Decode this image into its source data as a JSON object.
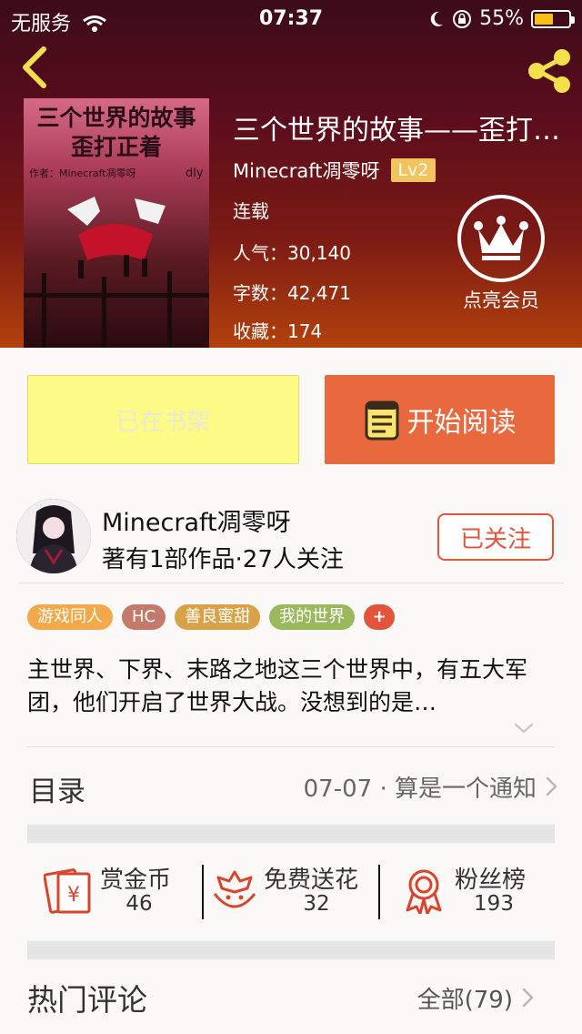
{
  "status_bar": {
    "carrier": "无服务",
    "time": "07:37",
    "battery": "55%",
    "battery_level": 0.55
  },
  "book": {
    "title": "三个世界的故事——歪打正着",
    "author": "Minecraft凋零呀",
    "level": "Lv2",
    "status": "连载",
    "popularity_label": "人气：",
    "popularity": "30,140",
    "word_count_label": "字数：",
    "word_count": "42,471",
    "favorites_label": "收藏：",
    "favorites": "174",
    "cover": {
      "line1": "三个世界的故事",
      "line2": "歪打正着",
      "byline": "作者：Minecraft凋零呀",
      "corner": "dly"
    }
  },
  "vip": {
    "label": "点亮会员"
  },
  "actions": {
    "shelf_label": "已在书架",
    "read_label": "开始阅读"
  },
  "author_card": {
    "name": "Minecraft凋零呀",
    "meta": "著有1部作品·27人关注",
    "follow_label": "已关注"
  },
  "tags": [
    {
      "label": "游戏同人",
      "color": "#f3a94a"
    },
    {
      "label": "HC",
      "color": "#c47a6a"
    },
    {
      "label": "善良蜜甜",
      "color": "#d9a248"
    },
    {
      "label": "我的世界",
      "color": "#9bb85c"
    },
    {
      "label": "+",
      "color": "#e2543b"
    }
  ],
  "synopsis": "主世界、下界、末路之地这三个世界中，有五大军团，他们开启了世界大战。没想到的是…",
  "toc": {
    "title": "目录",
    "latest": "07-07 · 算是一个通知"
  },
  "stats": [
    {
      "label": "赏金币",
      "value": "46",
      "icon": "red-envelope-icon"
    },
    {
      "label": "免费送花",
      "value": "32",
      "icon": "flower-icon"
    },
    {
      "label": "粉丝榜",
      "value": "193",
      "icon": "medal-icon"
    }
  ],
  "reviews": {
    "title": "热门评论",
    "all_label": "全部(79)"
  },
  "colors": {
    "accent": "#e9693f",
    "follow": "#e2543b",
    "shelf": "#fdfa85",
    "icon_red": "#d9452c",
    "header_top": "#3c0b19",
    "header_bottom": "#b3410c"
  }
}
